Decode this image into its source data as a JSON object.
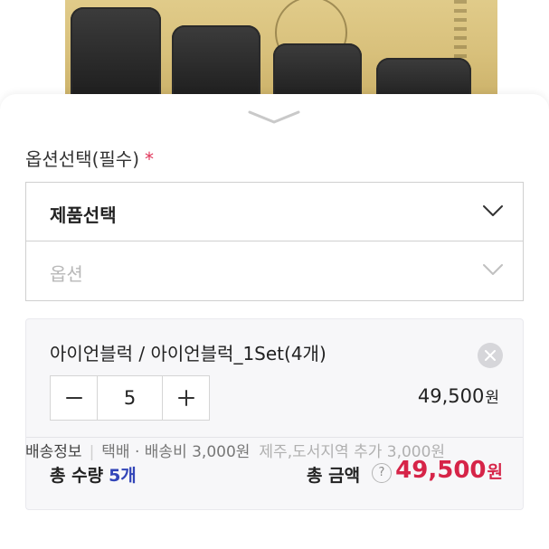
{
  "product": {
    "image_icon": "iron-block-product-photo"
  },
  "option_section": {
    "label": "옵션선택(필수)",
    "required_mark": "*",
    "product_select": {
      "value": "제품선택",
      "icon": "chevron-down-icon"
    },
    "option_select": {
      "placeholder": "옵션",
      "icon": "chevron-down-icon"
    }
  },
  "selected_item": {
    "name": "아이언블럭 / 아이언블럭_1Set(4개)",
    "quantity": "5",
    "minus_label": "−",
    "plus_label": "+",
    "price": "49,500",
    "currency": "원"
  },
  "summary": {
    "total_qty_label": "총 수량",
    "total_qty_value": "5개",
    "total_amount_label": "총 금액",
    "help_label": "?",
    "total_price": "49,500",
    "currency": "원"
  },
  "shipping": {
    "label": "배송정보",
    "separator": "|",
    "method": "택배 · 배송비 3,000원",
    "extra": "제주,도서지역 추가 3,000원"
  },
  "colors": {
    "accent_red": "#d62448",
    "qty_blue": "#3245b8",
    "required_star": "#e0355a"
  }
}
